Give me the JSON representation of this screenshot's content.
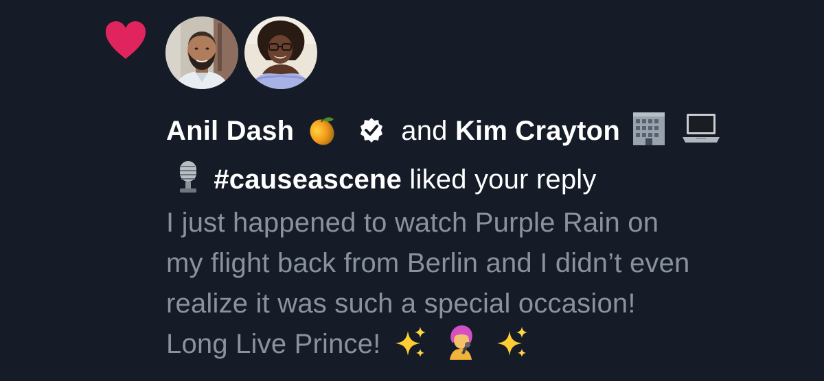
{
  "notification": {
    "type": "like",
    "heart_color": "#e0245e",
    "avatars": [
      {
        "name": "avatar-anil-dash"
      },
      {
        "name": "avatar-kim-crayton"
      }
    ],
    "user1": {
      "name": "Anil Dash",
      "emoji_icon": "mango-icon",
      "verified": true
    },
    "connector": "and",
    "user2": {
      "name": "Kim Crayton",
      "emoji_icons": [
        "office-building-icon",
        "laptop-icon",
        "microphone-icon"
      ],
      "hashtag": "#causeascene"
    },
    "action_text": "liked your reply",
    "reply": {
      "line1": "I just happened to watch Purple Rain on",
      "line2": "my flight back from Berlin and I didn’t even",
      "line3": "realize it was such a special occasion!",
      "line4": "Long Live Prince!",
      "trailing_icons": [
        "sparkles-icon",
        "woman-singer-icon",
        "sparkles-icon"
      ]
    }
  },
  "colors": {
    "background": "#151c28",
    "primary_text": "#ffffff",
    "secondary_text": "#8a929f"
  }
}
